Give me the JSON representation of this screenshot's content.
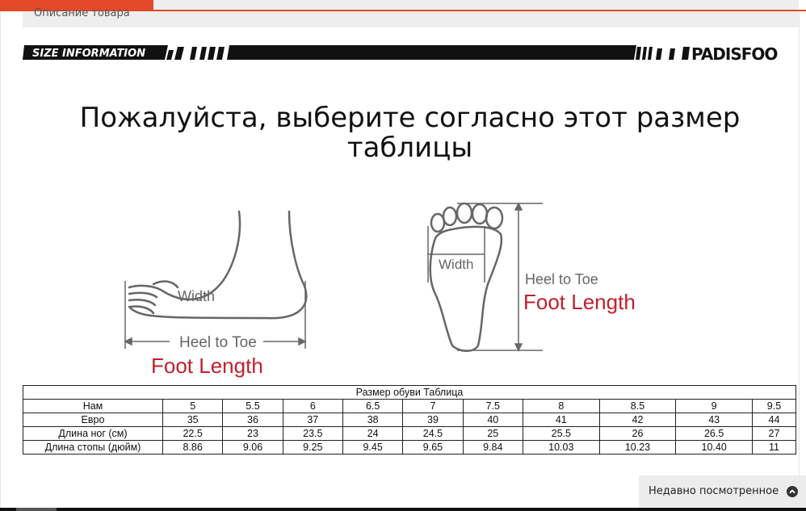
{
  "tabs": {
    "description_label": "Описание товара"
  },
  "banner": {
    "left_text": "SIZE INFORMATION",
    "brand": "PADISFOO"
  },
  "heading": "Пожалуйста, выберите согласно этот размер таблицы",
  "illustration": {
    "side": {
      "width_label": "Width",
      "heel_label": "Heel to Toe",
      "length_label": "Foot Length"
    },
    "sole": {
      "width_label": "Width",
      "heel_label": "Heel to Toe",
      "length_label": "Foot Length"
    },
    "accent_color": "#c0202e"
  },
  "size_table": {
    "caption": "Размер обуви Таблица",
    "rows": [
      {
        "label": "Нам",
        "values": [
          "5",
          "5.5",
          "6",
          "6.5",
          "7",
          "7.5",
          "8",
          "8.5",
          "9",
          "9.5"
        ]
      },
      {
        "label": "Евро",
        "values": [
          "35",
          "36",
          "37",
          "38",
          "39",
          "40",
          "41",
          "42",
          "43",
          "44"
        ]
      },
      {
        "label": "Длина ног (см)",
        "values": [
          "22.5",
          "23",
          "23.5",
          "24",
          "24.5",
          "25",
          "25.5",
          "26",
          "26.5",
          "27"
        ]
      },
      {
        "label": "Длина стопы (дюйм)",
        "values": [
          "8.86",
          "9.06",
          "9.25",
          "9.45",
          "9.65",
          "9.84",
          "10.03",
          "10.23",
          "10.40",
          "11"
        ]
      }
    ]
  },
  "recently_viewed": {
    "label": "Недавно посмотренное",
    "icon": "chevron-up-icon"
  },
  "colors": {
    "accent": "#e34a2a",
    "foot_length": "#c0202e"
  }
}
